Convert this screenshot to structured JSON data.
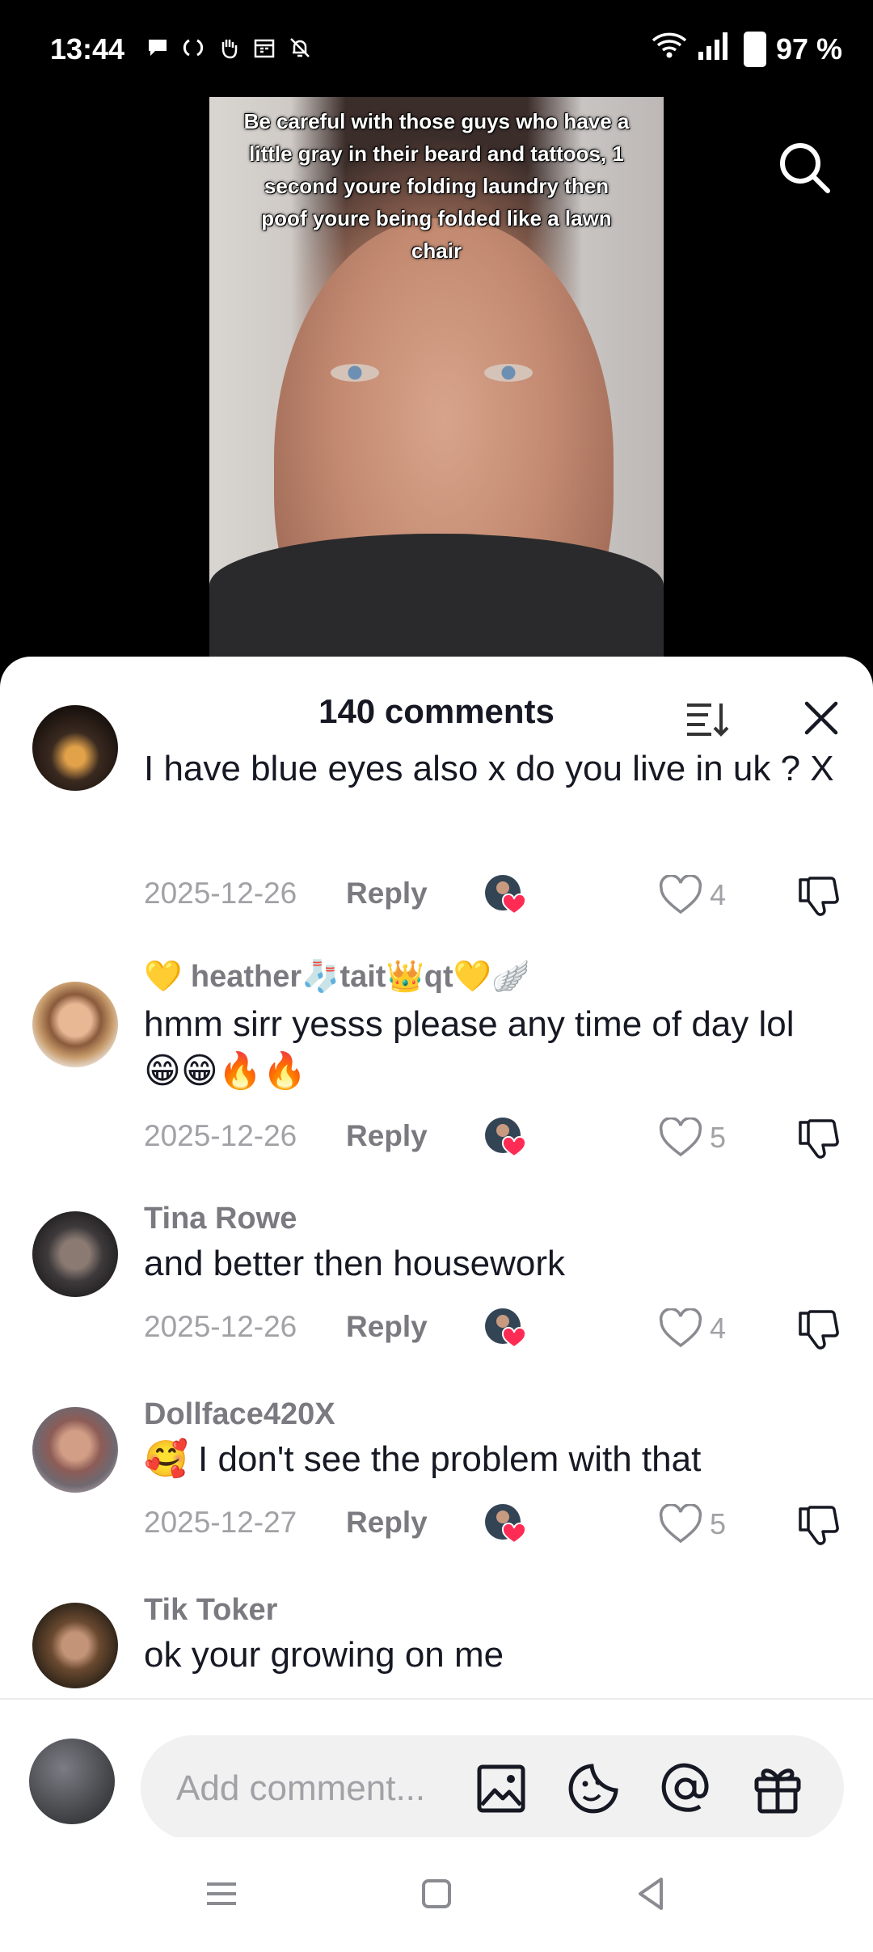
{
  "status_bar": {
    "time": "13:44",
    "battery": "97 %"
  },
  "video": {
    "caption": "Be careful with those guys who have a little gray in their beard and tattoos, 1 second youre folding laundry then poof youre being folded like a lawn chair"
  },
  "comments_panel": {
    "title": "140 comments",
    "reply_label": "Reply",
    "comments": [
      {
        "username": "",
        "text": "I have blue eyes also x do you live in uk ? X",
        "date": "2025-12-26",
        "likes": "4"
      },
      {
        "username": "💛 heather🧦tait👑qt💛🪽",
        "text": "hmm sirr yesss please any time of day lol 😁😁🔥🔥",
        "date": "2025-12-26",
        "likes": "5"
      },
      {
        "username": "Tina Rowe",
        "text": "and better then housework",
        "date": "2025-12-26",
        "likes": "4"
      },
      {
        "username": "Dollface420X",
        "text": "🥰 I don't see the problem with that",
        "date": "2025-12-27",
        "likes": "5"
      },
      {
        "username": "Tik Toker",
        "text": "ok your growing on me",
        "date": "",
        "likes": ""
      }
    ]
  },
  "composer": {
    "placeholder": "Add comment..."
  },
  "icons": {
    "search": "search-icon",
    "sort": "sort-icon",
    "close": "close-icon",
    "like": "heart-icon",
    "dislike": "thumbs-down-icon",
    "image": "image-icon",
    "sticker": "sticker-icon",
    "mention": "at-icon",
    "gift": "gift-icon"
  },
  "colors": {
    "accent": "#fe2c55",
    "text": "#161823",
    "muted": "#a1a1a6"
  }
}
